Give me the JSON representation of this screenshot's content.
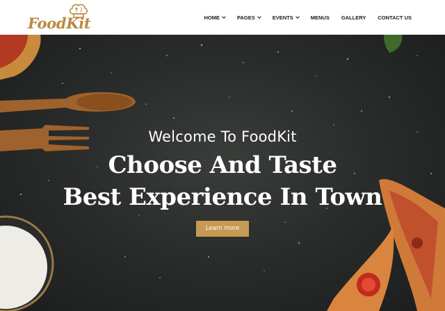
{
  "brand": {
    "name": "FoodKit",
    "color": "#b98a3f"
  },
  "nav": {
    "items": [
      {
        "label": "HOME",
        "dropdown": true
      },
      {
        "label": "PAGES",
        "dropdown": true
      },
      {
        "label": "EVENTS",
        "dropdown": true
      },
      {
        "label": "MENUS",
        "dropdown": false
      },
      {
        "label": "GALLERY",
        "dropdown": false
      },
      {
        "label": "CONTACT US",
        "dropdown": false
      }
    ]
  },
  "hero": {
    "welcome": "Welcome To FoodKit",
    "headline_line1": "Choose And Taste",
    "headline_line2": "Best Experience In Town",
    "cta_label": "Learn more",
    "cta_color": "#c69a52"
  }
}
